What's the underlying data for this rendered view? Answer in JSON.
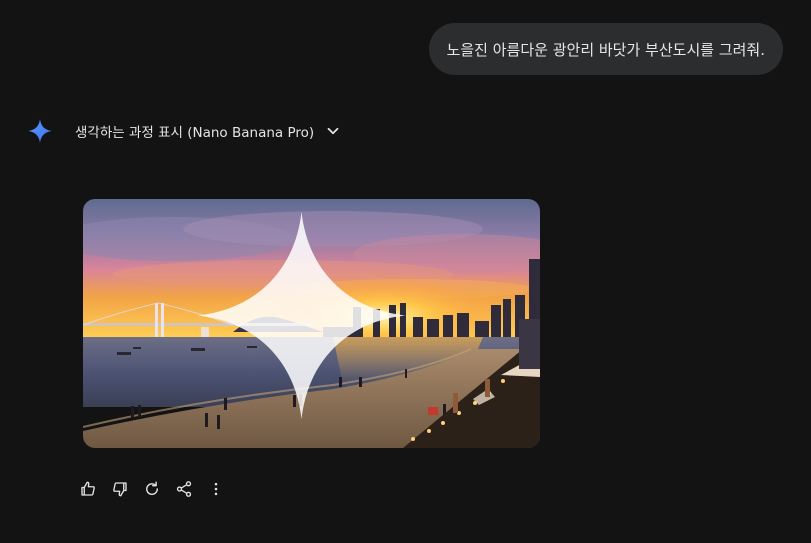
{
  "user_message": {
    "text": "노을진 아름다운 광안리 바닷가 부산도시를 그려줘."
  },
  "response": {
    "thinking_label": "생각하는 과정 표시 (Nano Banana Pro)",
    "image": {
      "subject": "Gwangalli beach at sunset with Gwangan Bridge and Busan skyline"
    },
    "actions": [
      {
        "name": "thumbs-up-icon"
      },
      {
        "name": "thumbs-down-icon"
      },
      {
        "name": "regenerate-icon"
      },
      {
        "name": "share-icon"
      },
      {
        "name": "more-vert-icon"
      }
    ]
  },
  "colors": {
    "background": "#131314",
    "bubble": "#2c2d2f",
    "gemini_blue": "#4c8df6",
    "text": "#e3e3e3"
  }
}
